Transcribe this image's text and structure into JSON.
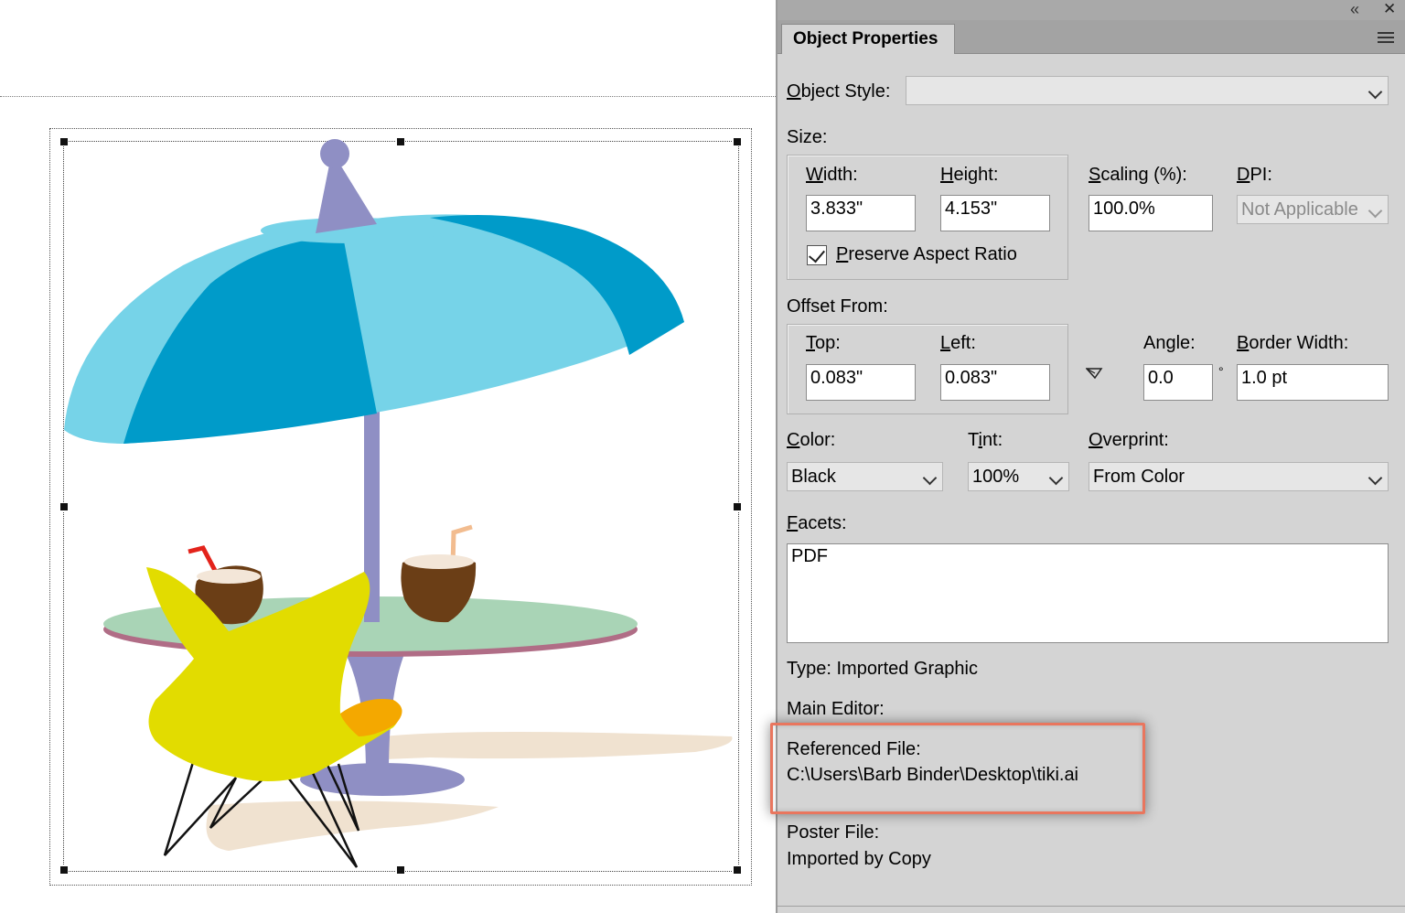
{
  "panel": {
    "title": "Object Properties",
    "collapse_icon": "«",
    "close_icon": "✕",
    "object_style": {
      "label": "Object Style:",
      "value": ""
    },
    "size": {
      "label": "Size:",
      "width_label": "Width:",
      "width_value": "3.833\"",
      "height_label": "Height:",
      "height_value": "4.153\"",
      "preserve_label": "Preserve Aspect Ratio",
      "preserve_checked": true,
      "scaling_label": "Scaling (%):",
      "scaling_value": "100.0%",
      "dpi_label": "DPI:",
      "dpi_value": "Not Applicable"
    },
    "offset": {
      "label": "Offset From:",
      "top_label": "Top:",
      "top_value": "0.083\"",
      "left_label": "Left:",
      "left_value": "0.083\"",
      "angle_label": "Angle:",
      "angle_value": "0.0",
      "degree": "°",
      "border_label": "Border Width:",
      "border_value": "1.0 pt"
    },
    "color": {
      "label": "Color:",
      "value": "Black"
    },
    "tint": {
      "label": "Tint:",
      "value": "100%"
    },
    "overprint": {
      "label": "Overprint:",
      "value": "From Color"
    },
    "facets": {
      "label": "Facets:",
      "value": "PDF"
    },
    "type": "Type: Imported Graphic",
    "main_editor": "Main Editor:",
    "referenced_file": {
      "label": "Referenced File:",
      "path": "C:\\Users\\Barb Binder\\Desktop\\tiki.ai"
    },
    "poster_file": {
      "label": "Poster File:",
      "value": "Imported by Copy"
    }
  },
  "colors": {
    "panel_bg": "#d4d4d4",
    "highlight": "#e9765e",
    "umbrella_dark": "#009bc9",
    "umbrella_light": "#76d3e8",
    "pole": "#8f8fc4",
    "table_top": "#a9d4b6",
    "chair": "#e2dc00"
  }
}
